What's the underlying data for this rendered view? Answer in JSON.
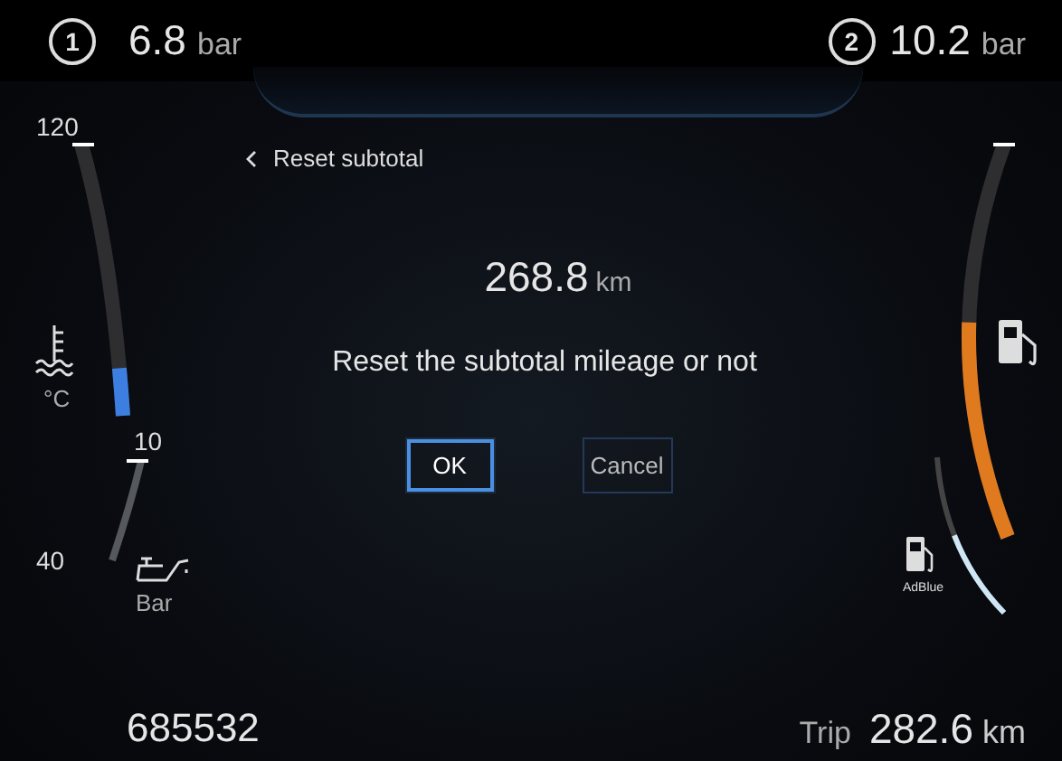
{
  "pressure_readings": [
    {
      "circuit": "1",
      "value": "6.8",
      "unit": "bar"
    },
    {
      "circuit": "2",
      "value": "10.2",
      "unit": "bar"
    }
  ],
  "left_gauges": [
    {
      "kind": "temperature",
      "max_label": "120",
      "min_label": "40",
      "unit": "°C",
      "level": 0.15
    },
    {
      "kind": "oil_pressure",
      "max_label": "10",
      "unit": "Bar"
    }
  ],
  "right_gauges": [
    {
      "kind": "fuel",
      "level": 0.55
    },
    {
      "kind": "adblue",
      "label": "AdBlue",
      "level": 0.55
    }
  ],
  "dialog": {
    "back_label": "Reset subtotal",
    "distance": "268.8",
    "unit": "km",
    "message": "Reset the subtotal mileage or not",
    "buttons": [
      {
        "label": "OK",
        "selected": true
      },
      {
        "label": "Cancel",
        "selected": false
      }
    ]
  },
  "odometer": "685532",
  "trip": {
    "label": "Trip",
    "value": "282.6",
    "unit": "km"
  }
}
